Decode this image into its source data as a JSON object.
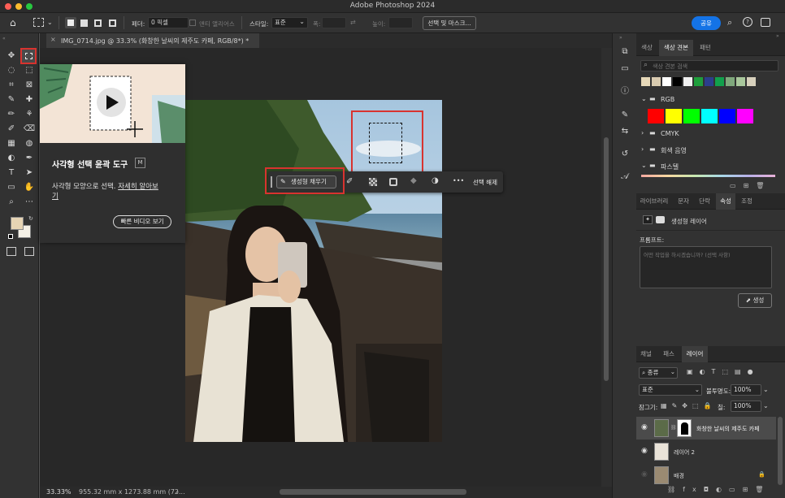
{
  "app": {
    "title": "Adobe Photoshop 2024"
  },
  "options": {
    "feather_label": "페더:",
    "feather_value": "0 픽셀",
    "antialias_label": "앤티 앨리어스",
    "style_label": "스타일:",
    "style_value": "표준",
    "width_label": "폭:",
    "height_label": "높이:",
    "select_mask_label": "선택 및 마스크...",
    "share_label": "공유"
  },
  "document": {
    "tab_title": "IMG_0714.jpg @ 33.3% (화창한 날씨의 제주도 카페, RGB/8*) *"
  },
  "status": {
    "zoom": "33.33%",
    "size": "955.32 mm x 1273.88 mm (72...",
    "chevron": "›"
  },
  "tooltip": {
    "title": "사각형 선택 윤곽 도구",
    "shortcut": "M",
    "desc_prefix": "사각형 모양으로 선택.",
    "learn_more": "자세히 알아보",
    "learn_more_cont": "기",
    "video_button": "빠른 비디오 보기"
  },
  "context_bar": {
    "generative_fill": "생성형 채우기",
    "more": "•••",
    "deselect": "선택 해제"
  },
  "swatches_panel": {
    "tabs": [
      "색상",
      "색상 견본",
      "패턴"
    ],
    "search_placeholder": "색상 견본 검색",
    "recent": [
      "#e6d8b8",
      "#d9cbb0",
      "#ffffff",
      "#000000",
      "#f0f0f0",
      "#1e9e3c",
      "#2c3e8c",
      "#12a04c",
      "#7fa87c",
      "#a9c79c",
      "#d7d0bc"
    ],
    "groups": [
      {
        "name": "RGB",
        "colors": [
          "#ff0000",
          "#ffff00",
          "#00ff00",
          "#00ffff",
          "#0000ff",
          "#ff00ff"
        ]
      },
      {
        "name": "CMYK"
      },
      {
        "name": "회색 음영"
      },
      {
        "name": "파스텔"
      }
    ]
  },
  "properties_panel": {
    "tabs": [
      "라이브러리",
      "문자",
      "단락",
      "속성",
      "조정"
    ],
    "layer_type": "생성형 레이어",
    "prompt_label": "프롬프트:",
    "prompt_placeholder": "어떤 작업을 하시겠습니까? (선택 사항)",
    "generate_label": "생성"
  },
  "layers_panel": {
    "tabs": [
      "채널",
      "패스",
      "레이어"
    ],
    "kind_label": "종류",
    "blend_mode": "표준",
    "opacity_label": "불투명도:",
    "opacity_value": "100%",
    "lock_label": "잠그기:",
    "fill_label": "칠:",
    "fill_value": "100%",
    "layers": [
      {
        "name": "화창한 날씨의 제주도 카페",
        "selected": true
      },
      {
        "name": "레이어 2",
        "selected": false
      },
      {
        "name": "배경",
        "selected": false
      }
    ]
  }
}
